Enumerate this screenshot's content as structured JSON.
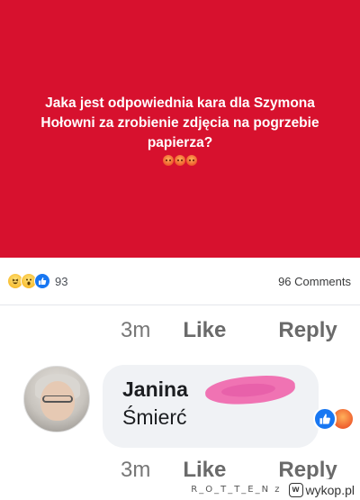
{
  "post": {
    "lines": [
      "Jaka jest odpowiednia kara dla Szymona",
      "Hołowni za zrobienie zdjęcia na pogrzebie",
      "papierza?"
    ],
    "banner_color": "#d7112e",
    "emojis": [
      "angry-emoji",
      "angry-emoji",
      "angry-emoji"
    ]
  },
  "reactions_bar": {
    "icons": [
      "haha-reaction-icon",
      "wow-reaction-icon",
      "like-reaction-icon"
    ],
    "count": "93",
    "comments_label": "96 Comments"
  },
  "comment_actions_top": {
    "time": "3m",
    "like": "Like",
    "reply": "Reply"
  },
  "comment": {
    "author": "Janina",
    "text": "Śmierć",
    "reactions": [
      "like-reaction-icon",
      "angry-reaction-icon"
    ]
  },
  "comment_actions_bottom": {
    "time": "3m",
    "like": "Like",
    "reply": "Reply"
  },
  "watermark": {
    "user": "R_O_T_T_E_N z",
    "site": "wykop.pl"
  },
  "colors": {
    "like_blue": "#1877f2",
    "redaction_pink": "#f06db0"
  }
}
